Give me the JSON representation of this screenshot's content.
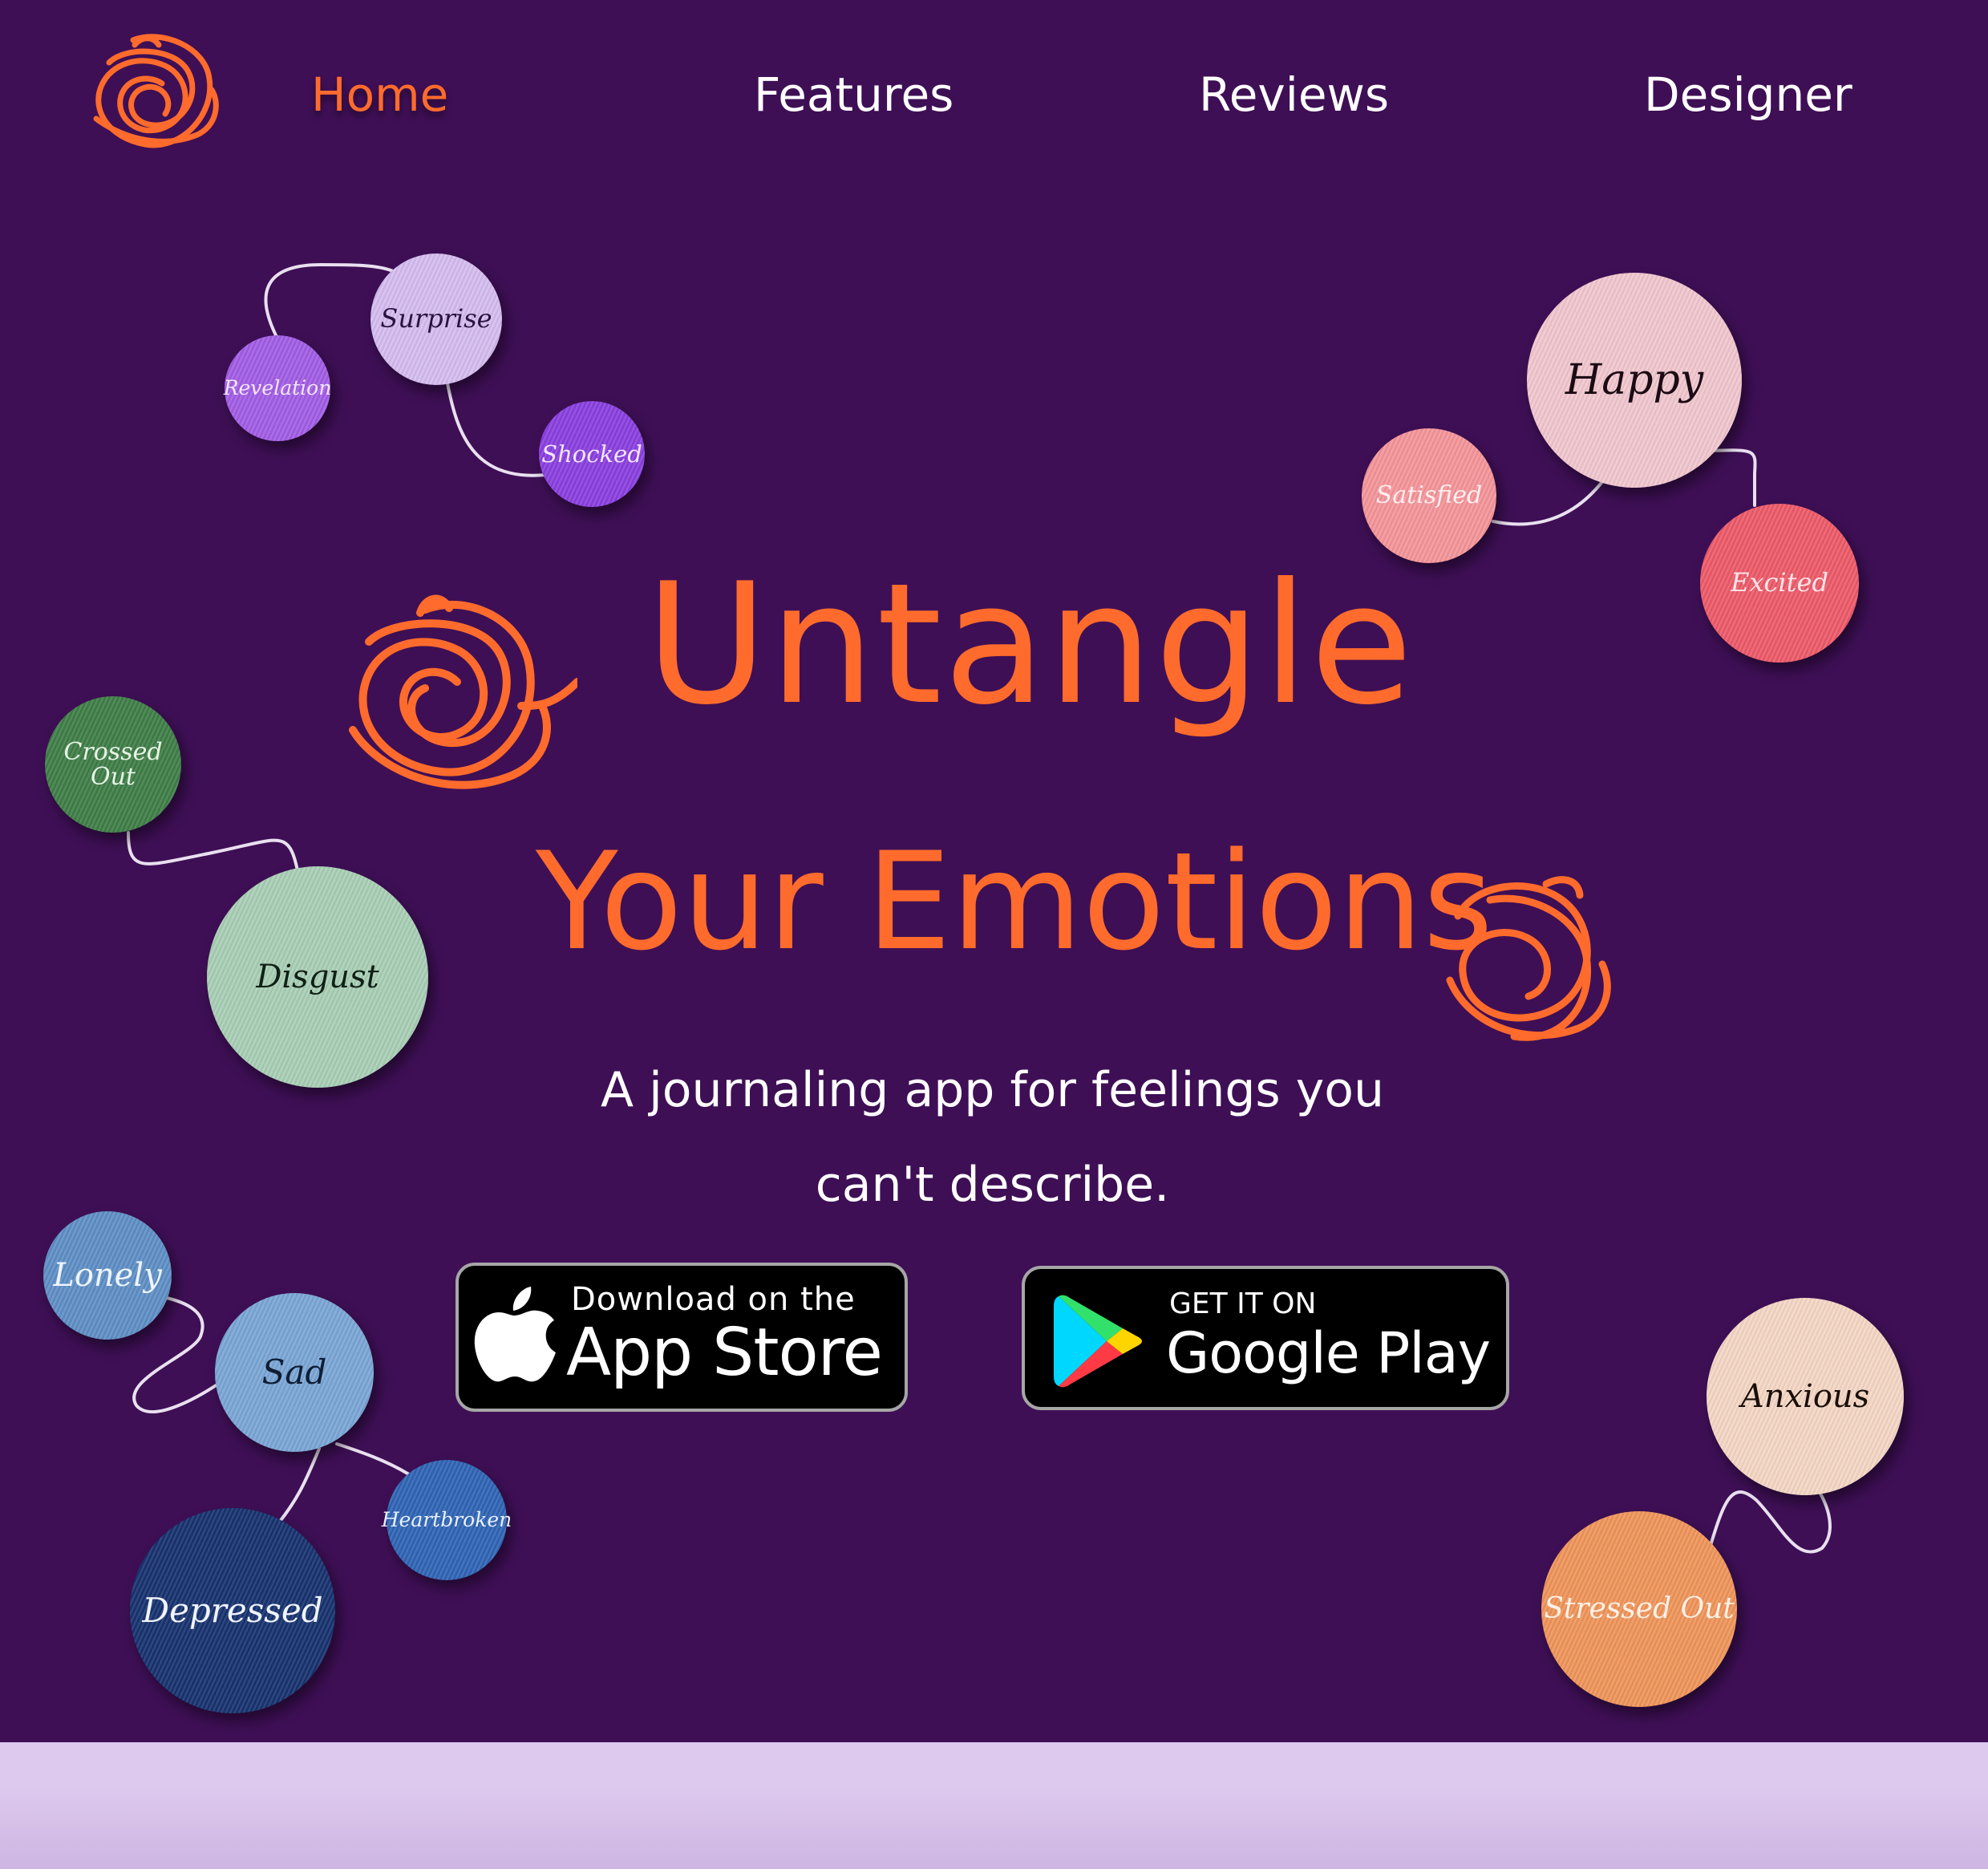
{
  "nav": {
    "logo_icon": "tangle-logo-icon",
    "items": [
      {
        "label": "Home",
        "active": true
      },
      {
        "label": "Features",
        "active": false
      },
      {
        "label": "Reviews",
        "active": false
      },
      {
        "label": "Designer",
        "active": false
      }
    ]
  },
  "hero": {
    "headline_line1": "Untangle",
    "headline_line2": "Your Emotions",
    "tagline_line1": "A journaling app for feelings you",
    "tagline_line2": "can't describe."
  },
  "emotions": {
    "surprise": "Surprise",
    "revelation": "Revelation",
    "shocked": "Shocked",
    "happy": "Happy",
    "satisfied": "Satisfied",
    "excited": "Excited",
    "crossed_out": "Crossed Out",
    "disgust": "Disgust",
    "lonely": "Lonely",
    "sad": "Sad",
    "heartbroken": "Heartbroken",
    "depressed": "Depressed",
    "anxious": "Anxious",
    "stressed_out": "Stressed Out"
  },
  "badges": {
    "appstore": {
      "small": "Download on the",
      "big": "App Store",
      "icon": "apple-icon"
    },
    "googleplay": {
      "small": "GET IT ON",
      "big": "Google Play",
      "icon": "google-play-icon"
    }
  },
  "colors": {
    "background": "#3e0f55",
    "accent": "#ff6b2c",
    "footer_band": "#ddc9ee"
  }
}
